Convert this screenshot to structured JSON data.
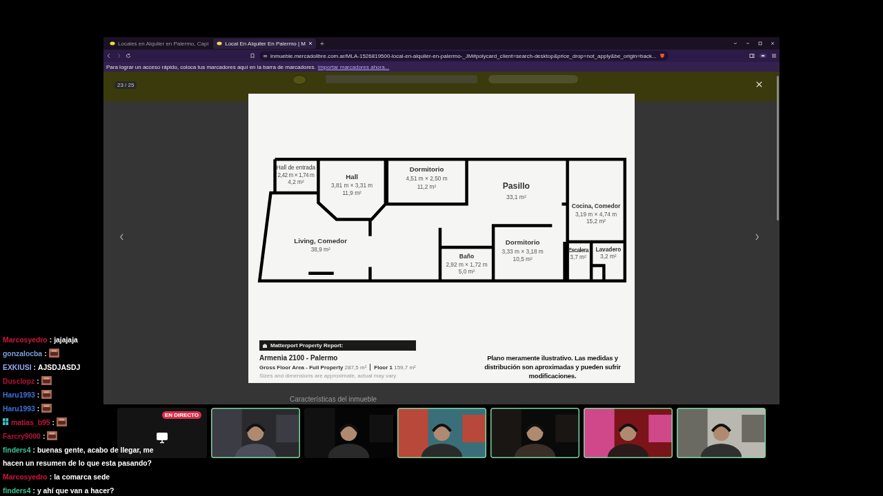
{
  "browser": {
    "tabs": [
      {
        "label": "Locales en Alquiler en Palermo, Capi",
        "selected": false
      },
      {
        "label": "Local En Alquiler En Palermo | M",
        "selected": true
      }
    ],
    "new_tab": "+",
    "url": "inmueble.mercadolibre.com.ar/MLA-1526819500-local-en-alquiler-en-palermo-_JM#polycard_client=search-desktop&price_drop=not_apply&be_origin=back...",
    "bookmarks_hint": "Para lograr un acceso rápido, coloca tus marcadores aquí en la barra de marcadores.",
    "bookmarks_link": "Importar marcadores ahora..."
  },
  "page": {
    "section_title": "Características del inmueble"
  },
  "lightbox": {
    "counter": "23 / 25",
    "rooms": [
      {
        "name": "Hall de entrada",
        "dimensions": "2,42 m × 1,74 m",
        "area": "4,2 m²"
      },
      {
        "name": "Hall",
        "dimensions": "3,81 m × 3,31 m",
        "area": "11,9 m²"
      },
      {
        "name": "Dormitorio",
        "dimensions": "4,51 m × 2,50 m",
        "area": "11,2 m²"
      },
      {
        "name": "Pasillo",
        "area": "33,1 m²"
      },
      {
        "name": "Cocina, Comedor",
        "dimensions": "3,19 m × 4,74 m",
        "area": "15,2 m²"
      },
      {
        "name": "Living, Comedor",
        "area": "38,9 m²"
      },
      {
        "name": "Baño",
        "dimensions": "2,92 m × 1,72 m",
        "area": "5,0 m²"
      },
      {
        "name": "Dormitorio",
        "dimensions": "3,33 m × 3,18 m",
        "area": "10,5 m²"
      },
      {
        "name": "Escalera",
        "area": "3,7 m²"
      },
      {
        "name": "Lavadero",
        "area": "3,2 m²"
      }
    ],
    "report_title": "Matterport Property Report:",
    "address": "Armenia 2100 - Palermo",
    "areas": [
      "**Gross Floor Area - Full Property** 287,5 m²",
      "**Floor 1** 159,7 m²"
    ],
    "disclaimer": "Sizes and dimensions are approximate, actual may vary",
    "note": "Plano meramente ilustrativo. Las medidas y distribución son aproximadas y pueden sufrir modificaciones."
  },
  "chat": [
    {
      "user": "Marcosyedro",
      "color": "#d0163c",
      "sep": ":",
      "kind": "text",
      "text": "jajajaja"
    },
    {
      "user": "gonzalocba",
      "color": "#7a9fdc",
      "sep": ":",
      "kind": "emote"
    },
    {
      "user": "EXKIUSI",
      "color": "#9aa8ec",
      "sep": ":",
      "kind": "text",
      "text": "AJSDJASDJ"
    },
    {
      "user": "Dusclopz",
      "color": "#b8123c",
      "sep": ":",
      "kind": "emote"
    },
    {
      "user": "Haru1993",
      "color": "#3f72dc",
      "sep": ":",
      "kind": "emote"
    },
    {
      "user": "Haru1993",
      "color": "#3f72dc",
      "sep": ":",
      "kind": "emote"
    },
    {
      "user": "matias_b95",
      "color": "#c4123e",
      "sep": ":",
      "kind": "emote",
      "badge": true
    },
    {
      "user": "Farcry9000",
      "color": "#b8123c",
      "sep": ":",
      "kind": "emote"
    },
    {
      "user": "finders4",
      "color": "#3cc49a",
      "sep": ":",
      "kind": "text",
      "text": "buenas gente, acabo de llegar, me hacen un resumen de lo que esta pasando?"
    },
    {
      "user": "Marcosyedro",
      "color": "#d0163c",
      "sep": ":",
      "kind": "text",
      "text": "la comarca sede"
    },
    {
      "user": "finders4",
      "color": "#3cc49a",
      "sep": ":",
      "kind": "text",
      "text": "y ahí que van a hacer?"
    }
  ],
  "stream": {
    "live_badge": "EN DIRECTO",
    "cameras": [
      {
        "kind": "picture",
        "highlighted": true
      },
      {
        "kind": "picture",
        "highlighted": false
      },
      {
        "kind": "picture",
        "highlighted": true
      },
      {
        "kind": "picture",
        "highlighted": true
      },
      {
        "kind": "picture",
        "highlighted": true
      },
      {
        "kind": "picture",
        "highlighted": true
      }
    ]
  }
}
